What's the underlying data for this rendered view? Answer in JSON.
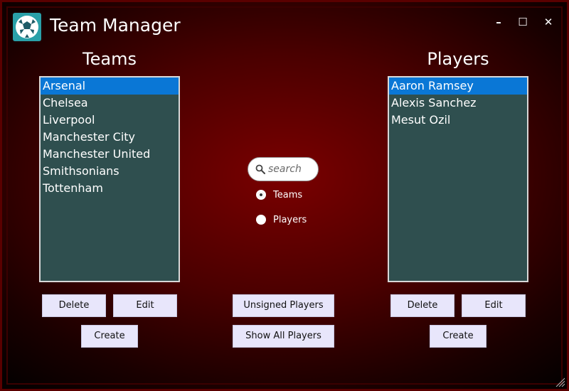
{
  "window": {
    "title": "Team Manager",
    "controls": {
      "minimize": "–",
      "maximize": "☐",
      "close": "✕"
    }
  },
  "teams": {
    "title": "Teams",
    "items": [
      "Arsenal",
      "Chelsea",
      "Liverpool",
      "Manchester City",
      "Manchester United",
      "Smithsonians",
      "Tottenham"
    ],
    "selected": "Arsenal",
    "buttons": {
      "delete": "Delete",
      "edit": "Edit",
      "create": "Create"
    }
  },
  "players": {
    "title": "Players",
    "items": [
      "Aaron Ramsey",
      "Alexis Sanchez",
      "Mesut Ozil"
    ],
    "selected": "Aaron Ramsey",
    "buttons": {
      "delete": "Delete",
      "edit": "Edit",
      "create": "Create"
    }
  },
  "search": {
    "placeholder": "search",
    "icon": "search-icon",
    "options": [
      {
        "label": "Teams",
        "checked": true
      },
      {
        "label": "Players",
        "checked": false
      }
    ]
  },
  "center_buttons": {
    "unsigned_players": "Unsigned Players",
    "show_all_players": "Show All Players"
  },
  "colors": {
    "list_background": "#2f4f4f",
    "selection": "#0a77d6",
    "button_background": "#e8e6fb",
    "window_background": "#5a0000",
    "logo_teal": "#2aa0a8"
  }
}
